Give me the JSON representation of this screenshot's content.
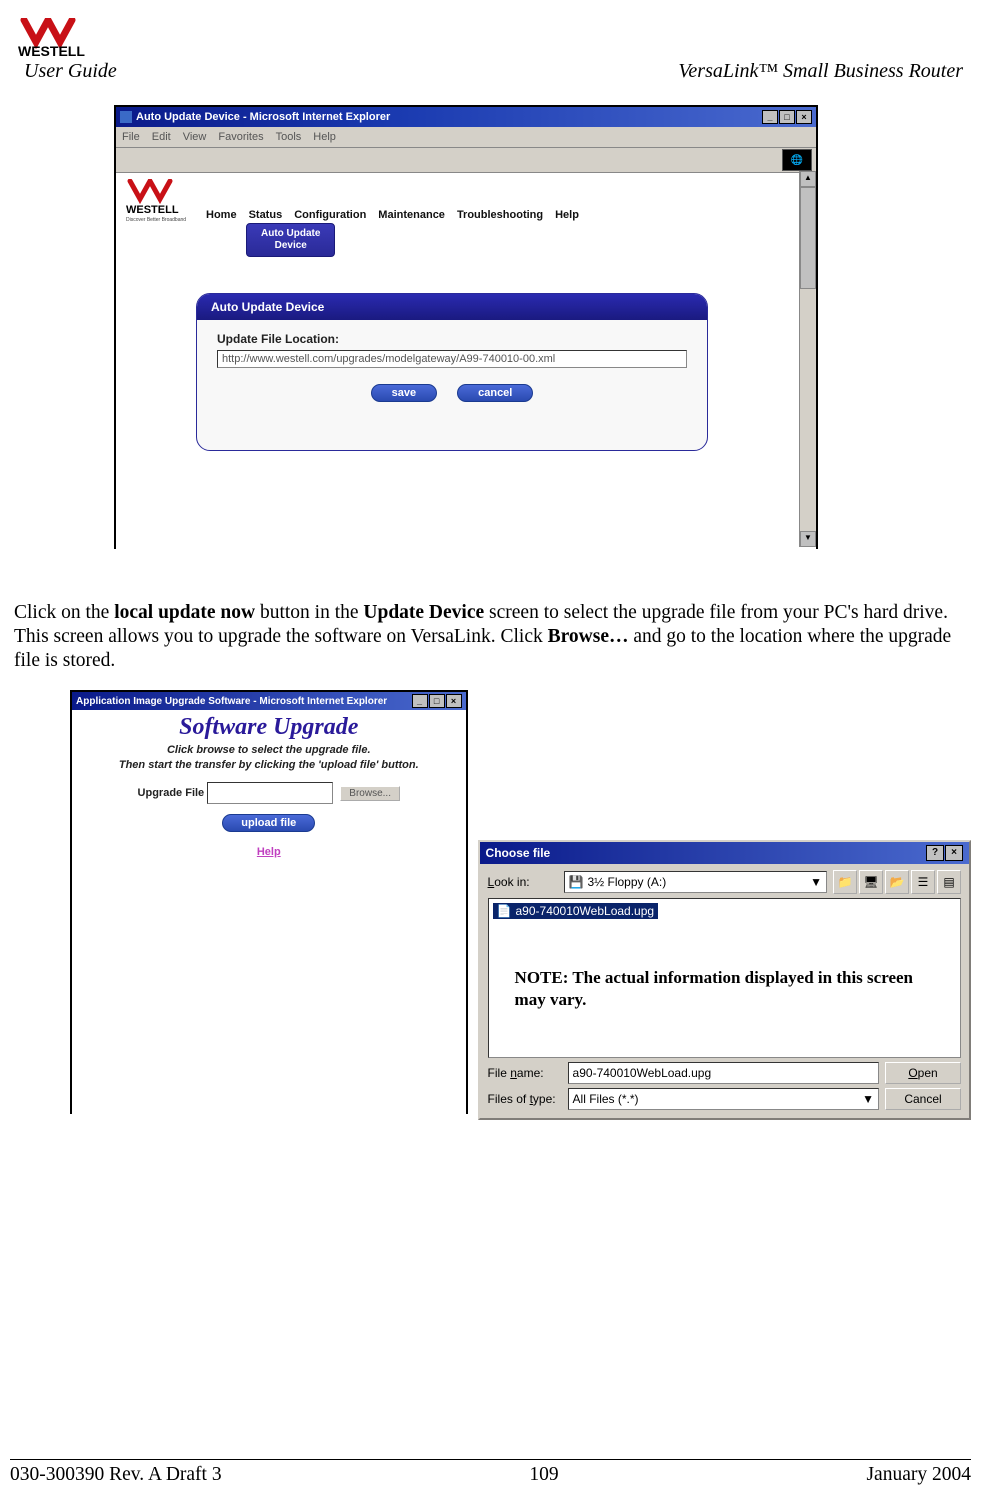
{
  "header": {
    "brand": "WESTELL",
    "tagline": "Discover Better Broadband",
    "user_guide": "User Guide",
    "product": "VersaLink™  Small Business Router"
  },
  "ie_window1": {
    "title": "Auto Update Device - Microsoft Internet Explorer",
    "menu": [
      "File",
      "Edit",
      "View",
      "Favorites",
      "Tools",
      "Help"
    ],
    "nav": [
      "Home",
      "Status",
      "Configuration",
      "Maintenance",
      "Troubleshooting",
      "Help"
    ],
    "sub_button": "Auto Update\nDevice",
    "card_title": "Auto Update Device",
    "field_label": "Update File Location:",
    "url_value": "http://www.westell.com/upgrades/modelgateway/A99-740010-00.xml",
    "save_label": "save",
    "cancel_label": "cancel"
  },
  "para": {
    "t1": "Click on the ",
    "b1": "local update now",
    "t2": " button in the ",
    "b2": "Update Device",
    "t3": " screen to select the upgrade file from your PC's hard drive. This screen allows you to upgrade the software on VersaLink. Click ",
    "b3": "Browse…",
    "t4": " and go to the location where the upgrade file is stored."
  },
  "ie_window2": {
    "title": "Application Image Upgrade Software - Microsoft Internet Explorer",
    "heading": "Software Upgrade",
    "sub1": "Click browse to select the upgrade file.",
    "sub2": "Then start the transfer by clicking the 'upload file' button.",
    "field_label": "Upgrade File",
    "browse_label": "Browse...",
    "upload_label": "upload file",
    "help_label": "Help"
  },
  "choose_file": {
    "title": "Choose file",
    "look_in_label": "Look in:",
    "look_in_value": "3½ Floppy (A:)",
    "selected_file": "a90-740010WebLoad.upg",
    "note": "NOTE: The actual information displayed in this screen may vary.",
    "file_name_label": "File name:",
    "file_name_value": "a90-740010WebLoad.upg",
    "file_type_label": "Files of type:",
    "file_type_value": "All Files (*.*)",
    "open_label": "Open",
    "cancel_label": "Cancel"
  },
  "footer": {
    "left": "030-300390 Rev. A Draft 3",
    "center": "109",
    "right": "January 2004"
  }
}
